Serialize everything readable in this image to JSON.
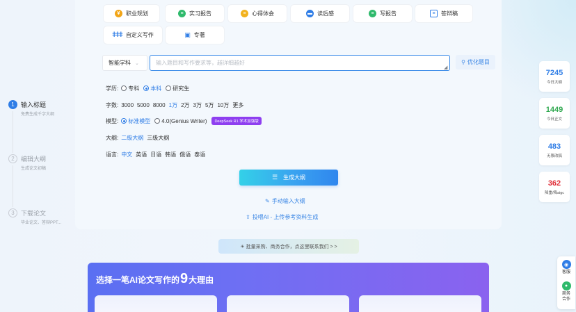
{
  "steps": [
    {
      "num": "1",
      "title": "输入标题",
      "sub": "免费生成千字大纲"
    },
    {
      "num": "2",
      "title": "编辑大纲",
      "sub": "生成论文初稿"
    },
    {
      "num": "3",
      "title": "下载论文",
      "sub": "毕业论文、答辩PPT..."
    }
  ],
  "categories": [
    {
      "label": "职业规划",
      "icon": "briefcase-icon",
      "color": "#f2a516"
    },
    {
      "label": "实习报告",
      "icon": "report-icon",
      "color": "#2fba6c"
    },
    {
      "label": "心得体会",
      "icon": "notes-icon",
      "color": "#f2b21e"
    },
    {
      "label": "读后感",
      "icon": "book-icon",
      "color": "#2f7de6"
    },
    {
      "label": "写报告",
      "icon": "write-report-icon",
      "color": "#2fba6c"
    },
    {
      "label": "答辩稿",
      "icon": "document-icon",
      "color": "#2f7de6"
    },
    {
      "label": "自定义写作",
      "icon": "sliders-icon",
      "color": "#2f7de6"
    },
    {
      "label": "专著",
      "icon": "open-book-icon",
      "color": "#2f7de6"
    }
  ],
  "subject_select": {
    "value": "智能学科"
  },
  "prompt": {
    "placeholder": "输入题目和写作要求等，越详细越好"
  },
  "optimize_label": "优化题目",
  "education": {
    "label": "学历:",
    "options": [
      "专科",
      "本科",
      "研究生"
    ],
    "selected": "本科"
  },
  "wordcount": {
    "label": "字数:",
    "options": [
      "3000",
      "5000",
      "8000",
      "1万",
      "2万",
      "3万",
      "5万",
      "10万",
      "更多"
    ],
    "selected": "1万"
  },
  "model": {
    "label": "模型:",
    "options": [
      "标准模型",
      "4.0(Genius Writer)"
    ],
    "selected": "标准模型",
    "badge": "DeepSeek R1 学术加强版"
  },
  "outline": {
    "label": "大纲:",
    "options": [
      "二级大纲",
      "三级大纲"
    ],
    "selected": "二级大纲"
  },
  "language": {
    "label": "语言:",
    "options": [
      "中文",
      "英语",
      "日语",
      "韩语",
      "俄语",
      "泰语"
    ],
    "selected": "中文"
  },
  "generate_label": "生成大纲",
  "manual_label": "手动输入大纲",
  "upload_label": "投喂AI - 上传参考资料生成",
  "notice": "☀ 批量采购、商务合作，点这里联系我们 > >",
  "promo": {
    "title_prefix": "选择一笔AI论文写作的",
    "title_number": "9",
    "title_suffix": "大理由"
  },
  "stats": [
    {
      "value": "7245",
      "label": "今日大纲",
      "color": "#2f7de6"
    },
    {
      "value": "1449",
      "label": "今日正文",
      "color": "#2fa84f"
    },
    {
      "value": "483",
      "label": "无限改稿",
      "color": "#2f7de6"
    },
    {
      "value": "362",
      "label": "降重/降aigc",
      "color": "#e0303a"
    }
  ],
  "float_bar": [
    {
      "label": "客服",
      "icon": "service-icon",
      "color": "#2f7de6"
    },
    {
      "label": "商务\n合作",
      "icon": "chat-icon",
      "color": "#2fba6c"
    }
  ]
}
